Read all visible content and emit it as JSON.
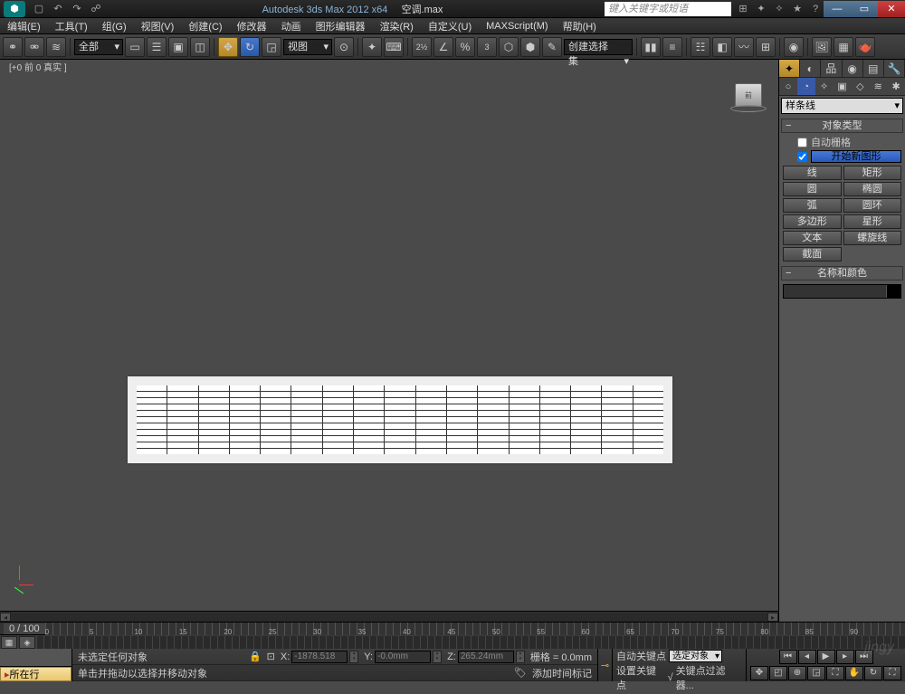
{
  "title": {
    "app": "Autodesk 3ds Max  2012 x64",
    "file": "空调.max",
    "search_placeholder": "键入关键字或短语"
  },
  "menu": [
    "编辑(E)",
    "工具(T)",
    "组(G)",
    "视图(V)",
    "创建(C)",
    "修改器",
    "动画",
    "图形编辑器",
    "渲染(R)",
    "自定义(U)",
    "MAXScript(M)",
    "帮助(H)"
  ],
  "toolbar": {
    "selection_filter": "全部",
    "view_dd": "视图",
    "named_sel": "创建选择集"
  },
  "viewport": {
    "label": "[+0 前 0 真实 ]",
    "cube_face": "前"
  },
  "panel": {
    "spline_dd": "样条线",
    "rollout_objtype": "对象类型",
    "auto_grid": "自动栅格",
    "start_new": "开始新图形",
    "buttons": [
      "线",
      "矩形",
      "圆",
      "椭圆",
      "弧",
      "圆环",
      "多边形",
      "星形",
      "文本",
      "螺旋线",
      "截面"
    ],
    "rollout_namecolor": "名称和颜色"
  },
  "timeline": {
    "frame": "0 / 100",
    "marks": [
      "0",
      "5",
      "10",
      "15",
      "20",
      "25",
      "30",
      "35",
      "40",
      "45",
      "50",
      "55",
      "60",
      "65",
      "70",
      "75",
      "80",
      "85",
      "90"
    ]
  },
  "status": {
    "row_label": "所在行",
    "no_sel": "未选定任何对象",
    "hint": "单击并拖动以选择并移动对象",
    "x": "-1878.518",
    "y": "-0.0mm",
    "z": "265.24mm",
    "grid": "栅格 = 0.0mm",
    "add_time": "添加时间标记",
    "auto_key": "自动关键点",
    "set_key": "设置关键点",
    "sel_obj": "选定对象",
    "key_filter": "关键点过滤器..."
  },
  "watermark": "jingy"
}
